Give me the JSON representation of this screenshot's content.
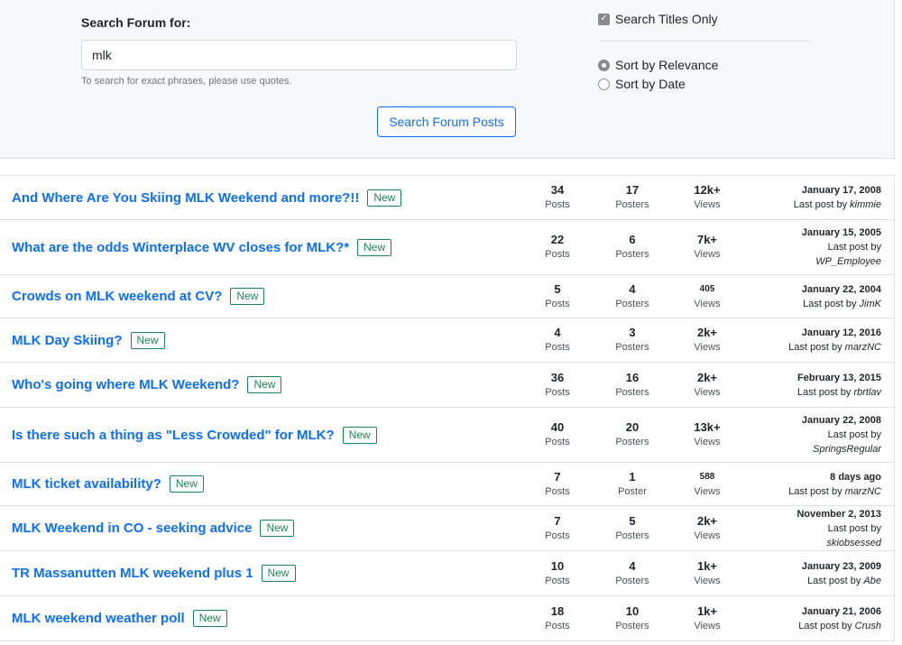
{
  "search": {
    "label": "Search Forum for:",
    "value": "mlk",
    "hint": "To search for exact phrases, please use quotes.",
    "button": "Search Forum Posts",
    "titles_only_label": "Search Titles Only",
    "titles_only_checked": true,
    "sort_relevance_label": "Sort by Relevance",
    "sort_date_label": "Sort by Date",
    "sort_selected": "relevance"
  },
  "colors": {
    "link": "#0d6efd",
    "badge": "#198754",
    "panel_bg": "#f8f9fa"
  },
  "results": [
    {
      "title": "And Where Are You Skiing MLK Weekend and more?!!",
      "badge": "New",
      "posts": "34",
      "posts_label": "Posts",
      "posters": "17",
      "posters_label": "Posters",
      "views": "12k+",
      "views_label": "Views",
      "date": "January 17, 2008",
      "last_post_prefix": "Last post by",
      "user": "kimmie"
    },
    {
      "title": "What are the odds Winterplace WV closes for MLK?*",
      "badge": "New",
      "posts": "22",
      "posts_label": "Posts",
      "posters": "6",
      "posters_label": "Posters",
      "views": "7k+",
      "views_label": "Views",
      "date": "January 15, 2005",
      "last_post_prefix": "Last post by",
      "user": "WP_Employee"
    },
    {
      "title": "Crowds on MLK weekend at CV?",
      "badge": "New",
      "posts": "5",
      "posts_label": "Posts",
      "posters": "4",
      "posters_label": "Posters",
      "views": "405",
      "views_label": "Views",
      "date": "January 22, 2004",
      "last_post_prefix": "Last post by",
      "user": "JimK"
    },
    {
      "title": "MLK Day Skiing?",
      "badge": "New",
      "posts": "4",
      "posts_label": "Posts",
      "posters": "3",
      "posters_label": "Posters",
      "views": "2k+",
      "views_label": "Views",
      "date": "January 12, 2016",
      "last_post_prefix": "Last post by",
      "user": "marzNC"
    },
    {
      "title": "Who's going where MLK Weekend?",
      "badge": "New",
      "posts": "36",
      "posts_label": "Posts",
      "posters": "16",
      "posters_label": "Posters",
      "views": "2k+",
      "views_label": "Views",
      "date": "February 13, 2015",
      "last_post_prefix": "Last post by",
      "user": "rbrtlav"
    },
    {
      "title": "Is there such a thing as \"Less Crowded\" for MLK?",
      "badge": "New",
      "posts": "40",
      "posts_label": "Posts",
      "posters": "20",
      "posters_label": "Posters",
      "views": "13k+",
      "views_label": "Views",
      "date": "January 22, 2008",
      "last_post_prefix": "Last post by",
      "user": "SpringsRegular"
    },
    {
      "title": "MLK ticket availability?",
      "badge": "New",
      "posts": "7",
      "posts_label": "Posts",
      "posters": "1",
      "posters_label": "Poster",
      "views": "588",
      "views_label": "Views",
      "date": "8 days ago",
      "last_post_prefix": "Last post by",
      "user": "marzNC"
    },
    {
      "title": "MLK Weekend in CO - seeking advice",
      "badge": "New",
      "posts": "7",
      "posts_label": "Posts",
      "posters": "5",
      "posters_label": "Posters",
      "views": "2k+",
      "views_label": "Views",
      "date": "November 2, 2013",
      "last_post_prefix": "Last post by",
      "user": "skiobsessed"
    },
    {
      "title": "TR Massanutten MLK weekend plus 1",
      "badge": "New",
      "posts": "10",
      "posts_label": "Posts",
      "posters": "4",
      "posters_label": "Posters",
      "views": "1k+",
      "views_label": "Views",
      "date": "January 23, 2009",
      "last_post_prefix": "Last post by",
      "user": "Abe"
    },
    {
      "title": "MLK weekend weather poll",
      "badge": "New",
      "posts": "18",
      "posts_label": "Posts",
      "posters": "10",
      "posters_label": "Posters",
      "views": "1k+",
      "views_label": "Views",
      "date": "January 21, 2006",
      "last_post_prefix": "Last post by",
      "user": "Crush"
    }
  ]
}
